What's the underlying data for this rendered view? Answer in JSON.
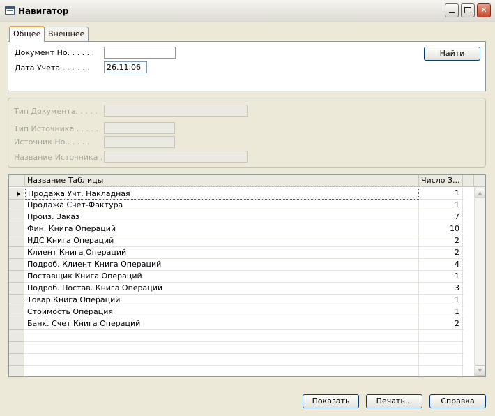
{
  "window": {
    "title": "Навигатор"
  },
  "tabs": [
    {
      "label": "Общее"
    },
    {
      "label": "Внешнее"
    }
  ],
  "general": {
    "doc_no_label": "Документ Но. . . . . .",
    "doc_no_value": "",
    "posting_date_label": "Дата Учета . . . . . .",
    "posting_date_value": "26.11.06",
    "find_button_label": "Найти"
  },
  "source": {
    "doc_type_label": "Тип Документа. . . . .",
    "source_type_label": "Тип Источника . . . . .",
    "source_no_label": "Источник Но.. . . . .",
    "source_name_label": "Название Источника . ."
  },
  "grid": {
    "columns": [
      "Название Таблицы",
      "Число З..."
    ],
    "rows": [
      {
        "name": "Продажа Учт. Накладная",
        "count": "1"
      },
      {
        "name": "Продажа Счет-Фактура",
        "count": "1"
      },
      {
        "name": "Произ. Заказ",
        "count": "7"
      },
      {
        "name": "Фин. Книга Операций",
        "count": "10"
      },
      {
        "name": "НДС Книга Операций",
        "count": "2"
      },
      {
        "name": "Клиент Книга Операций",
        "count": "2"
      },
      {
        "name": "Подроб. Клиент Книга Операций",
        "count": "4"
      },
      {
        "name": "Поставщик Книга Операций",
        "count": "1"
      },
      {
        "name": "Подроб. Постав. Книга Операций",
        "count": "3"
      },
      {
        "name": "Товар Книга Операций",
        "count": "1"
      },
      {
        "name": "Стоимость Операция",
        "count": "1"
      },
      {
        "name": "Банк. Счет Книга Операций",
        "count": "2"
      }
    ]
  },
  "footer": {
    "show_button": "Показать",
    "print_button": "Печать...",
    "help_button": "Справка"
  }
}
